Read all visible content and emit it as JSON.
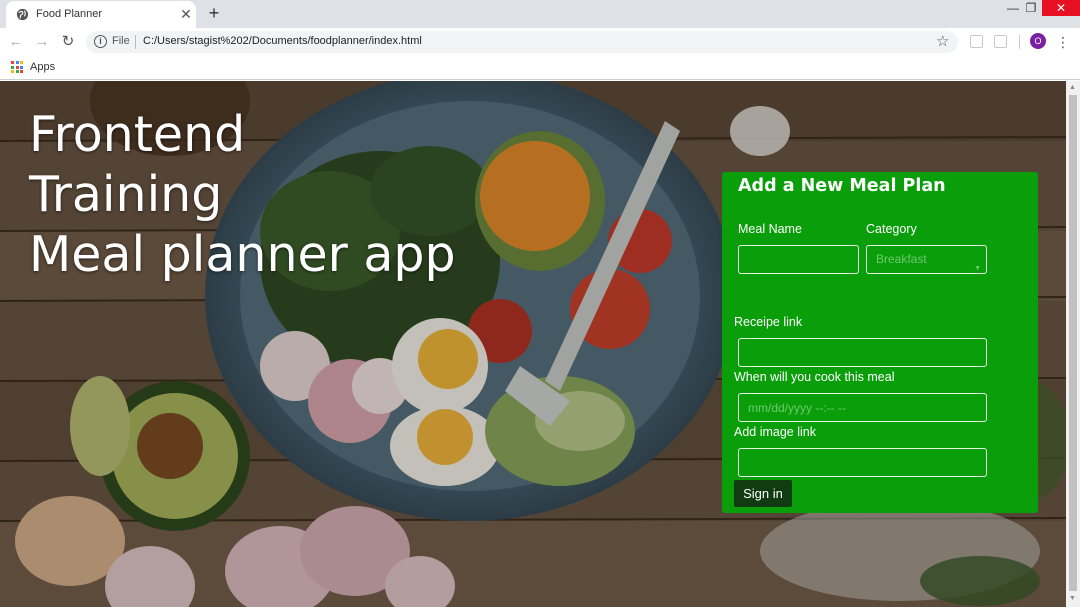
{
  "browser": {
    "tab_title": "Food Planner",
    "tab_close": "✕",
    "new_tab": "+",
    "window": {
      "minimize": "—",
      "maximize": "❐",
      "close": "✕"
    },
    "nav": {
      "back": "←",
      "forward": "→",
      "reload": "↻"
    },
    "scheme_label": "File",
    "url": "C:/Users/stagist%202/Documents/foodplanner/index.html",
    "star": "☆",
    "profile_initial": "O",
    "menu": "⋮",
    "bookmarks": {
      "apps_label": "Apps"
    },
    "colors": {
      "close_button": "#e81123",
      "profile": "#7b1fa2"
    }
  },
  "hero": {
    "lines": [
      "Frontend",
      "Training",
      "Meal planner app"
    ]
  },
  "form": {
    "title": "Add a New Meal Plan",
    "meal_name_label": "Meal Name",
    "category_label": "Category",
    "category_value": "Breakfast",
    "recipe_label": "Receipe link",
    "cook_date_label": "When will you cook this meal",
    "cook_date_placeholder": "mm/dd/yyyy --:-- --",
    "image_label": "Add image link",
    "submit_label": "Sign in",
    "colors": {
      "panel": "#0a9e0a",
      "button": "#113b11"
    }
  }
}
